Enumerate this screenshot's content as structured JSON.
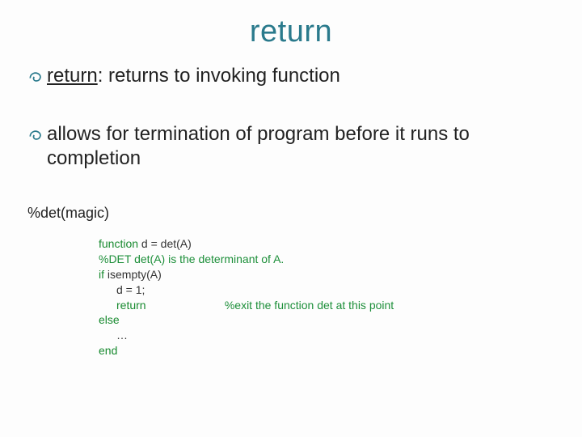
{
  "title": "return",
  "bullets": [
    {
      "term": "return",
      "rest": ": returns to invoking function"
    },
    {
      "text": "allows for termination of program before it runs to completion"
    }
  ],
  "det_magic": "%det(magic)",
  "code": {
    "l1_kw": "function",
    "l1_rest": " d = det(A)",
    "l2": "%DET det(A) is the determinant of A.",
    "l3_kw": "if",
    "l3_rest": " isempty(A)",
    "l4": "d = 1;",
    "l5_kw": "return",
    "l5_cmt": "%exit the function det at this point",
    "l6": "else",
    "l7": "…",
    "l8": "end"
  }
}
